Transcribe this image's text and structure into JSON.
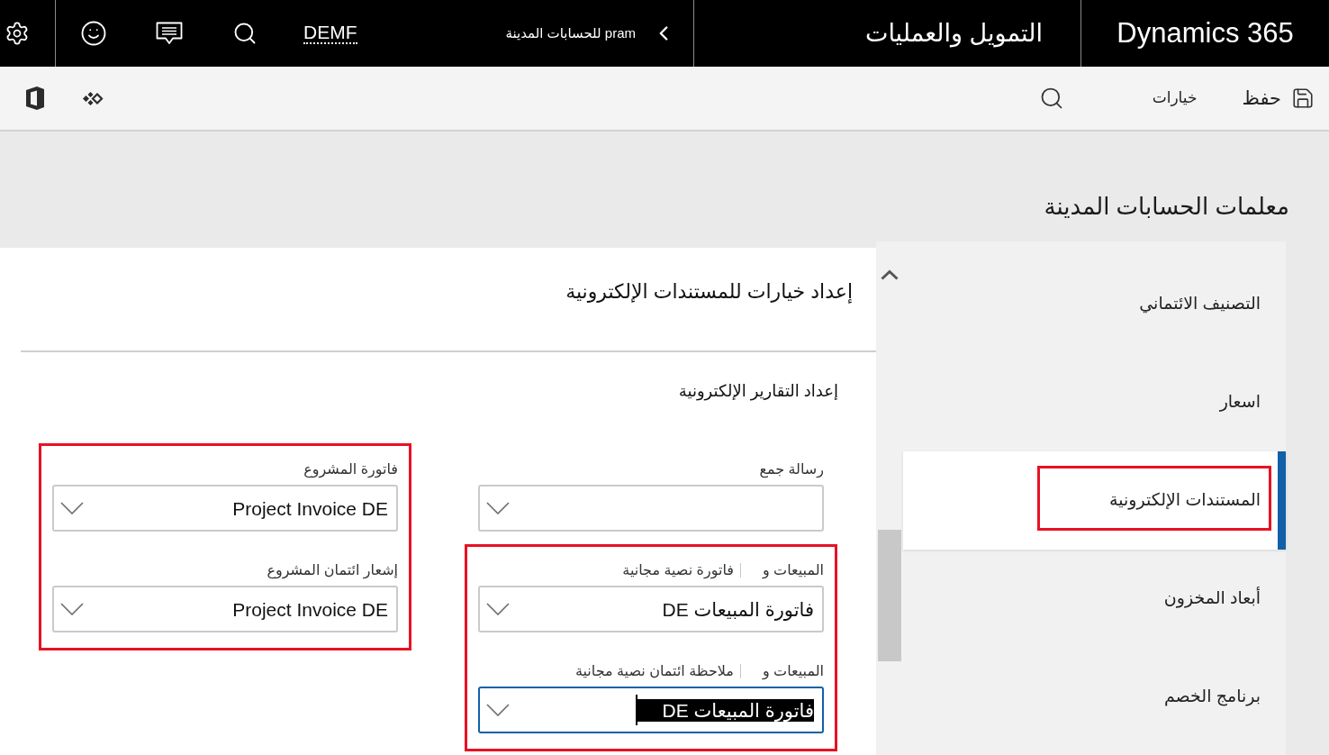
{
  "top_bar": {
    "product": "Dynamics 365",
    "app_name": "التمويل والعمليات",
    "breadcrumb": "pram للحسابات المدينة",
    "company": "DEMF"
  },
  "toolbar": {
    "actions": [
      {
        "kind": "save",
        "label": "حفظ"
      },
      {
        "kind": "options",
        "label": "خيارات"
      }
    ]
  },
  "page_title": "معلمات الحسابات المدينة",
  "nav": {
    "items": [
      {
        "label": "التصنيف الائتماني",
        "selected": false,
        "highlighted": false
      },
      {
        "label": "اسعار",
        "selected": false,
        "highlighted": false
      },
      {
        "label": "المستندات الإلكترونية",
        "selected": true,
        "highlighted": true
      },
      {
        "label": "أبعاد المخزون",
        "selected": false,
        "highlighted": false
      },
      {
        "label": "برنامج الخصم",
        "selected": false,
        "highlighted": false
      }
    ]
  },
  "section": {
    "title": "إعداد خيارات للمستندات الإلكترونية",
    "subtitle": "إعداد التقارير الإلكترونية"
  },
  "form": {
    "columns": [
      {
        "groups": [
          {
            "highlighted": false,
            "fields": [
              {
                "label_parts": [
                  "رسالة جمع"
                ],
                "focused": false
              }
            ]
          },
          {
            "highlighted": true,
            "fields": [
              {
                "label_parts": [
                  "المبيعات و",
                  "فاتورة نصية مجانية"
                ],
                "value": "فاتورة المبيعات DE",
                "focused": false,
                "text_selected": false
              },
              {
                "label_parts": [
                  "المبيعات و",
                  "ملاحظة ائتمان نصية مجانية"
                ],
                "value": "فاتورة المبيعات DE",
                "focused": true,
                "text_selected": true
              }
            ]
          }
        ]
      },
      {
        "groups": [
          {
            "highlighted": true,
            "fields": [
              {
                "label_parts": [
                  "فاتورة المشروع"
                ],
                "value": "Project Invoice DE",
                "focused": false,
                "text_selected": false
              },
              {
                "label_parts": [
                  "إشعار ائتمان المشروع"
                ],
                "value": "Project Invoice DE",
                "focused": false,
                "text_selected": false
              }
            ]
          }
        ]
      }
    ]
  }
}
